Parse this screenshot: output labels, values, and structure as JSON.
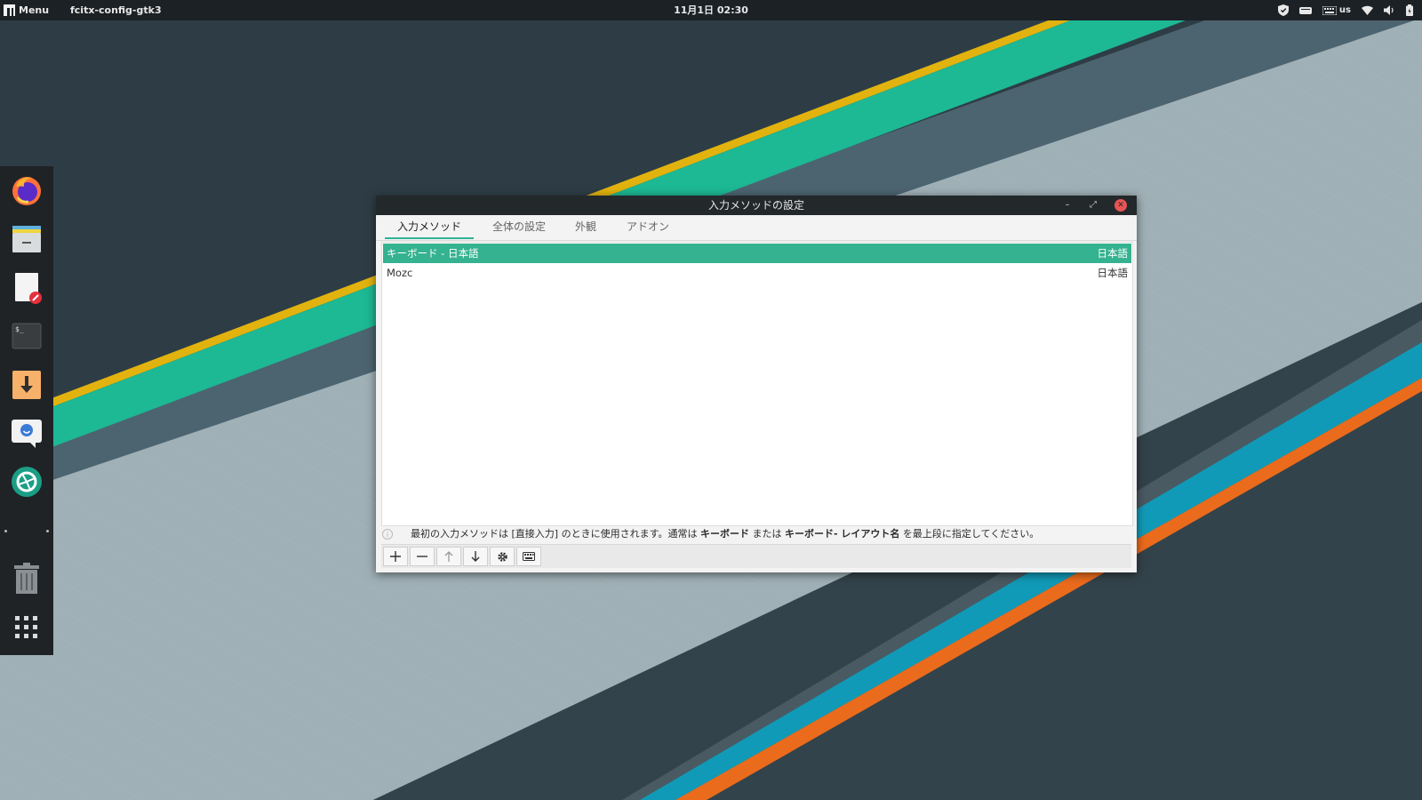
{
  "panel": {
    "menu_label": "Menu",
    "app_title": "fcitx-config-gtk3",
    "clock": "11月1日 02:30",
    "keyboard_layout": "us"
  },
  "dock": {
    "items": [
      "firefox-icon",
      "file-manager-icon",
      "text-editor-icon",
      "terminal-icon",
      "download-icon",
      "chat-icon",
      "screenshot-icon",
      "trash-icon",
      "app-grid-icon"
    ]
  },
  "window": {
    "title": "入力メソッドの設定",
    "tabs": [
      {
        "label": "入力メソッド",
        "active": true
      },
      {
        "label": "全体の設定",
        "active": false
      },
      {
        "label": "外観",
        "active": false
      },
      {
        "label": "アドオン",
        "active": false
      }
    ],
    "input_methods": [
      {
        "name": "キーボード - 日本語",
        "language": "日本語",
        "selected": true
      },
      {
        "name": "Mozc",
        "language": "日本語",
        "selected": false
      }
    ],
    "hint": {
      "part1": "最初の入力メソッドは [直接入力] のときに使用されます。通常は ",
      "bold1": "キーボード",
      "part2": " または ",
      "bold2": "キーボード- レイアウト名",
      "part3": " を最上段に指定してください。"
    },
    "toolbar": [
      "add-icon",
      "remove-icon",
      "move-up-icon",
      "move-down-icon",
      "configure-icon",
      "keyboard-layout-icon"
    ]
  },
  "colors": {
    "accent": "#35b28f",
    "panel": "#1c2125",
    "dock": "#1f2326"
  }
}
